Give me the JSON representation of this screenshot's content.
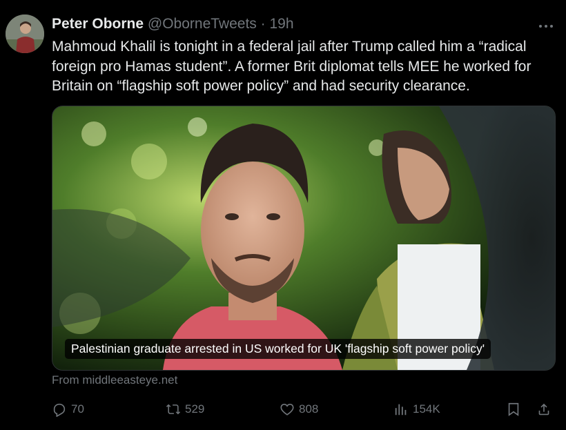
{
  "author": {
    "name": "Peter Oborne",
    "handle": "@OborneTweets",
    "separator": "·",
    "time": "19h"
  },
  "tweet": {
    "text": "Mahmoud Khalil is tonight in a federal jail after Trump called him a “radical foreign pro Hamas student”. A former Brit diplomat tells MEE he worked for Britain on “flagship soft power policy” and had security clearance."
  },
  "media": {
    "caption": "Palestinian graduate arrested in US worked for UK 'flagship soft power policy'",
    "source": "From middleeasteye.net"
  },
  "actions": {
    "replies": "70",
    "reposts": "529",
    "likes": "808",
    "views": "154K"
  },
  "icons": [
    "more-icon",
    "reply-icon",
    "repost-icon",
    "like-icon",
    "views-icon",
    "bookmark-icon",
    "share-icon"
  ],
  "colors": {
    "background": "#000000",
    "text": "#e7e9ea",
    "muted": "#71767b"
  }
}
